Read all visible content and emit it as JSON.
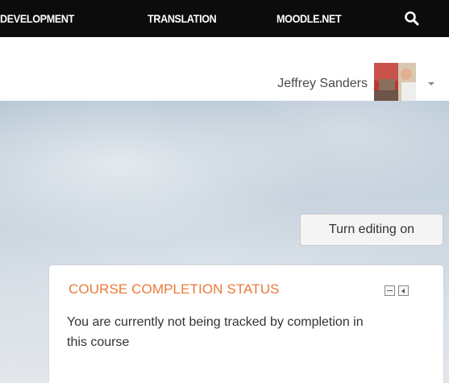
{
  "nav": {
    "items": [
      "DEVELOPMENT",
      "TRANSLATION",
      "MOODLE.NET"
    ],
    "search_icon": "search-icon"
  },
  "user": {
    "name": "Jeffrey Sanders",
    "avatar_icon": "avatar-photo",
    "menu_icon": "caret-down-icon"
  },
  "actions": {
    "edit_button": "Turn editing on"
  },
  "block": {
    "title": "COURSE COMPLETION STATUS",
    "body": "You are currently not being tracked by completion in this course",
    "controls": [
      "minimize-icon",
      "dock-icon"
    ]
  },
  "colors": {
    "nav_bg": "#0c0c0c",
    "block_title": "#e87a3a",
    "text": "#333333"
  }
}
